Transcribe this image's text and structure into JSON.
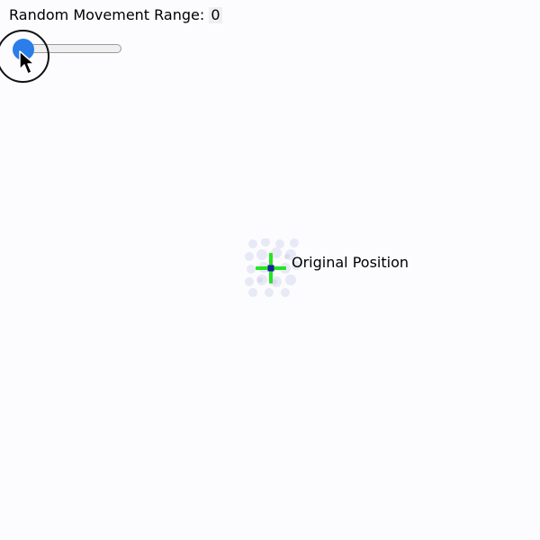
{
  "controls": {
    "range_label": "Random Movement Range:",
    "range_value": "0",
    "slider_value": 0
  },
  "scene": {
    "marker_label": "Original Position"
  },
  "colors": {
    "background": "#fcfbfe",
    "slider_thumb": "#2b7de9",
    "crosshair": "#22e622",
    "center_dot": "#1a1f9a",
    "particles": "#e8e9f6"
  },
  "icons": {
    "cursor": "mouse-pointer-icon",
    "crosshair": "crosshair-icon"
  }
}
